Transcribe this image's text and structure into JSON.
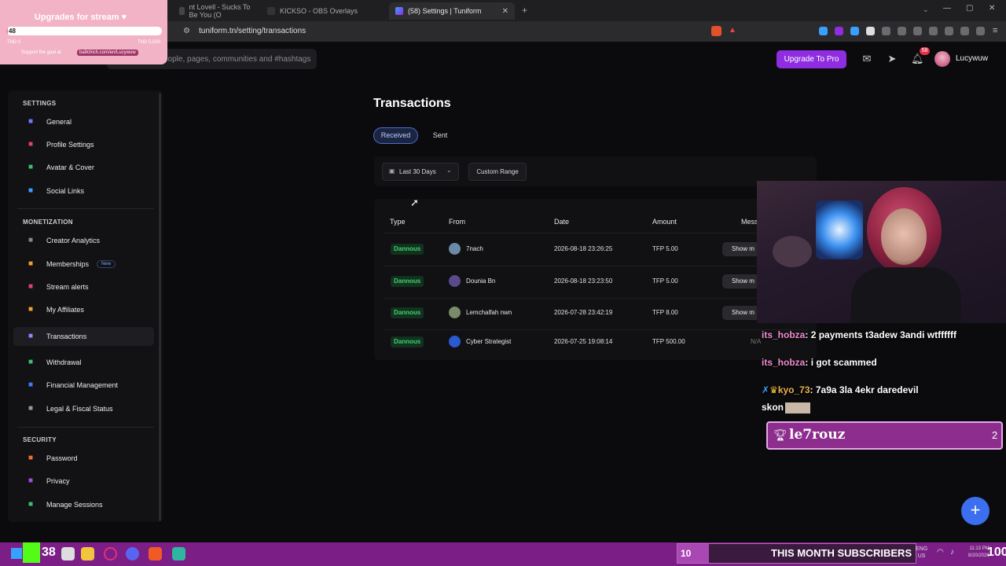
{
  "browser": {
    "tabs": [
      {
        "label": "nt Lovell - Sucks To Be You (O",
        "active": false
      },
      {
        "label": "KICKSO - OBS Overlays",
        "active": false
      },
      {
        "label": "(58) Settings | Tuniform",
        "active": true
      }
    ],
    "url": "tuniform.tn/setting/transactions"
  },
  "header": {
    "search_placeholder": "eople, pages, communities and #hashtags",
    "upgrade_label": "Upgrade To Pro",
    "notif_count": "58",
    "username": "Lucywuw"
  },
  "goal_overlay": {
    "title": "Upgrades for stream ♥",
    "current": "48",
    "progress_fraction": 0.0096,
    "min": "TND 0",
    "max": "TND 5,000",
    "support_text": "Support the goal at",
    "link": "ba9chich.com/en/Lucywuw"
  },
  "sidebar": {
    "sections": [
      {
        "heading": "SETTINGS",
        "items": [
          {
            "label": "General",
            "icon": "wrench-icon",
            "color": "#6f7bff"
          },
          {
            "label": "Profile Settings",
            "icon": "profile-icon",
            "color": "#e5405e"
          },
          {
            "label": "Avatar & Cover",
            "icon": "image-icon",
            "color": "#3fbf6a"
          },
          {
            "label": "Social Links",
            "icon": "twitter-icon",
            "color": "#3aa0ff"
          }
        ]
      },
      {
        "heading": "MONETIZATION",
        "items": [
          {
            "label": "Creator Analytics",
            "icon": "chart-icon",
            "color": "#888"
          },
          {
            "label": "Memberships",
            "icon": "members-icon",
            "color": "#f0a030",
            "badge": "New"
          },
          {
            "label": "Stream alerts",
            "icon": "broadcast-icon",
            "color": "#e0407a"
          },
          {
            "label": "My Affiliates",
            "icon": "link-icon",
            "color": "#f0a030"
          },
          {
            "label": "Transactions",
            "icon": "swap-icon",
            "color": "#8a8aff",
            "active": true
          },
          {
            "label": "Withdrawal",
            "icon": "cash-icon",
            "color": "#3fbf6a"
          },
          {
            "label": "Financial Management",
            "icon": "bank-icon",
            "color": "#3a7cff"
          },
          {
            "label": "Legal & Fiscal Status",
            "icon": "document-icon",
            "color": "#999"
          }
        ]
      },
      {
        "heading": "SECURITY",
        "items": [
          {
            "label": "Password",
            "icon": "lock-icon",
            "color": "#f07030"
          },
          {
            "label": "Privacy",
            "icon": "shield-icon",
            "color": "#a050e0"
          },
          {
            "label": "Manage Sessions",
            "icon": "sessions-icon",
            "color": "#3fbf6a"
          }
        ]
      }
    ]
  },
  "main": {
    "title": "Transactions",
    "tabs": {
      "received": "Received",
      "sent": "Sent"
    },
    "filters": {
      "range": "Last 30 Days",
      "custom": "Custom Range"
    },
    "columns": [
      "Type",
      "From",
      "Date",
      "Amount",
      "Mess"
    ],
    "rows": [
      {
        "type": "Dannous",
        "from": "7nach",
        "date": "2026-08-18 23:26:25",
        "amount": "TFP 5.00",
        "message": "Show m"
      },
      {
        "type": "Dannous",
        "from": "Dounia Bn",
        "date": "2026-08-18 23:23:50",
        "amount": "TFP 5.00",
        "message": "Show m"
      },
      {
        "type": "Dannous",
        "from": "Lemchalfah nwn",
        "date": "2026-07-28 23:42:19",
        "amount": "TFP 8.00",
        "message": "Show m"
      },
      {
        "type": "Dannous",
        "from": "Cyber Strategist",
        "date": "2026-07-25 19:08:14",
        "amount": "TFP 500.00",
        "message": "N/A"
      }
    ]
  },
  "chat": {
    "messages": [
      {
        "user": "its_hobza",
        "text": "2 payments t3adew 3andi wtffffff"
      },
      {
        "user": "its_hobza",
        "text": "i got scammed"
      },
      {
        "user": "kyo_73",
        "text": "7a9a 3la 4ekr daredevil",
        "text2": "skon"
      }
    ],
    "leader": {
      "name": "le7rouz",
      "count": "2"
    }
  },
  "taskbar": {
    "kick_count": "38",
    "subs_count": "10",
    "subs_label": "THIS MONTH SUBSCRIBERS",
    "lang1": "ENG",
    "lang2": "US",
    "time": "11:13 PM",
    "date": "8/20/2026",
    "volume": "100"
  },
  "colors": {
    "accent": "#8f2de0",
    "primary": "#3b6ff0",
    "success": "#3fd16e",
    "stream_purple": "#7b1f86"
  }
}
